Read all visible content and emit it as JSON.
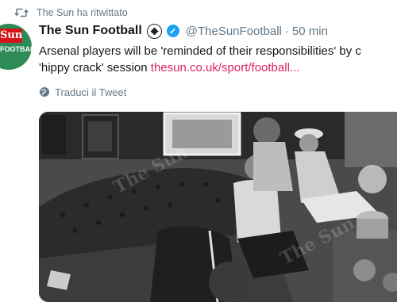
{
  "retweet": {
    "icon": "retweet-icon",
    "text": "The Sun ha ritwittato"
  },
  "tweet": {
    "avatar": {
      "logo_text": "Sun",
      "logo_sub": "FOOTBALL",
      "bg_color": "#2e8b57",
      "logo_color": "#d7141a"
    },
    "display_name": "The Sun Football",
    "name_emoji_icon": "soccer-ball-icon",
    "verified_icon": "verified-badge-icon",
    "handle": "@TheSunFootball",
    "separator": "·",
    "time": "50 min",
    "text_line1": "Arsenal players will be 'reminded of their responsibilities' by c",
    "text_line2_prefix": "'hippy crack' session ",
    "link": "thesun.co.uk/sport/football...",
    "link_color": "#e0245e",
    "translate_label": "Traduci il Tweet",
    "translate_icon": "globe-icon",
    "media": {
      "description_icon": "photo-image",
      "watermark": "The Sun"
    }
  }
}
